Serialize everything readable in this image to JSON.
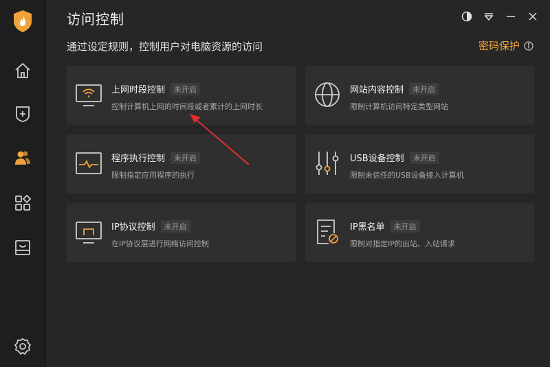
{
  "header": {
    "title": "访问控制",
    "subtitle": "通过设定规则，控制用户对电脑资源的访问",
    "password_label": "密码保护"
  },
  "colors": {
    "accent": "#f0a23a",
    "background": "#262626",
    "sidebar": "#1e1e1e",
    "card": "#2f2f2f",
    "annotation_arrow": "#e03030"
  },
  "sidebar": {
    "items": [
      {
        "icon": "home-icon"
      },
      {
        "icon": "shield-plus-icon"
      },
      {
        "icon": "users-icon",
        "active": true
      },
      {
        "icon": "apps-icon"
      },
      {
        "icon": "inbox-icon"
      },
      {
        "icon": "gear-icon"
      }
    ]
  },
  "window_controls": [
    "theme-icon",
    "menu-icon",
    "minimize-icon",
    "close-icon"
  ],
  "cards": [
    {
      "title": "上网时段控制",
      "status": "未开启",
      "desc": "控制计算机上网的时间段或者累计的上网时长",
      "icon": "monitor-wifi-icon"
    },
    {
      "title": "网站内容控制",
      "status": "未开启",
      "desc": "限制计算机访问特定类型网站",
      "icon": "globe-icon"
    },
    {
      "title": "程序执行控制",
      "status": "未开启",
      "desc": "限制指定应用程序的执行",
      "icon": "pulse-window-icon"
    },
    {
      "title": "USB设备控制",
      "status": "未开启",
      "desc": "限制未信任的USB设备接入计算机",
      "icon": "sliders-icon"
    },
    {
      "title": "IP协议控制",
      "status": "未开启",
      "desc": "在IP协议层进行网络访问控制",
      "icon": "monitor-ip-icon"
    },
    {
      "title": "IP黑名单",
      "status": "未开启",
      "desc": "限制对指定IP的出站、入站请求",
      "icon": "blacklist-doc-icon"
    }
  ]
}
